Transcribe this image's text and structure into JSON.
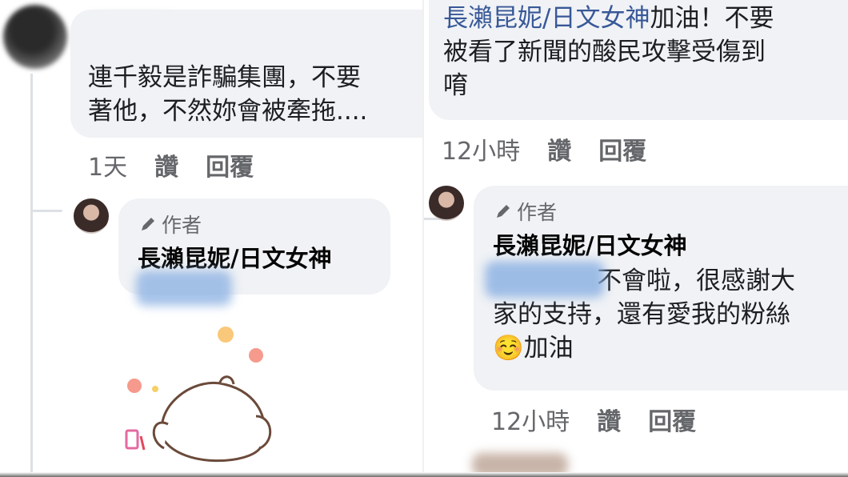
{
  "left": {
    "top_comment": {
      "text_line1": "連千毅是詐騙集團，不要",
      "text_line2": "著他，不然妳會被牽拖....",
      "time": "1天",
      "like_label": "讚",
      "reply_label": "回覆"
    },
    "reply": {
      "author_badge": "作者",
      "author_name": "長瀨昆妮/日文女神",
      "sticker_icon": "bear-sticker-icon"
    }
  },
  "right": {
    "top_comment": {
      "name_link": "長瀨昆妮/日文女神",
      "text_line1_suffix": "加油！不要",
      "text_line2": "被看了新聞的酸民攻擊受傷到",
      "text_line3": "唷",
      "time": "12小時",
      "like_label": "讚",
      "reply_label": "回覆"
    },
    "reply": {
      "author_badge": "作者",
      "author_name": "長瀨昆妮/日文女神",
      "text_line1": "不會啦，很感謝大",
      "text_line2": "家的支持，還有愛我的粉絲",
      "text_line3": "加油",
      "emoji": "☺️",
      "time": "12小時",
      "like_label": "讚",
      "reply_label": "回覆"
    }
  },
  "colors": {
    "bubble": "#f0f2f5",
    "meta": "#65676b",
    "link": "#385898",
    "text": "#1c1e21"
  }
}
